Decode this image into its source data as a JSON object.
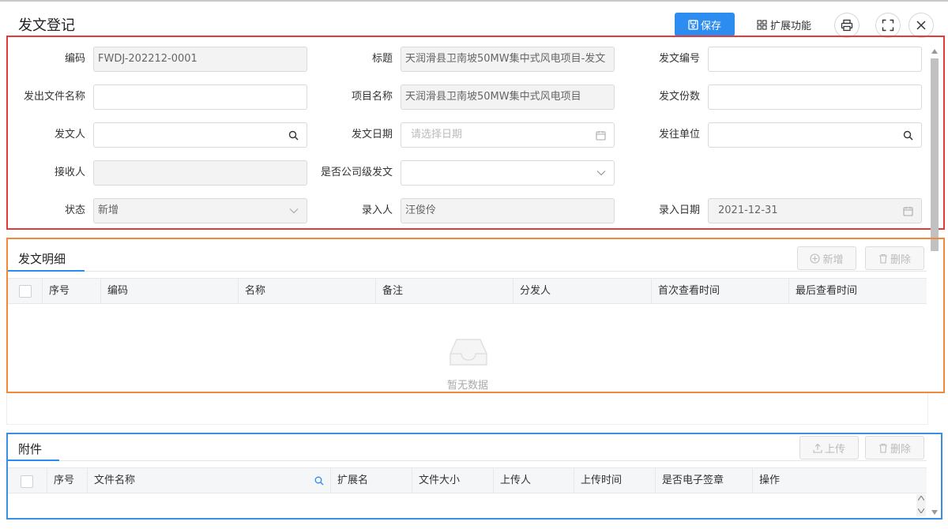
{
  "header": {
    "title": "发文登记",
    "save_label": "保存",
    "ext_label": "扩展功能"
  },
  "form": {
    "code_label": "编码",
    "code_value": "FWDJ-202212-0001",
    "title_label": "标题",
    "title_value": "天润滑县卫南坡50MW集中式风电项目-发文",
    "doc_no_label": "发文编号",
    "doc_no_value": "",
    "out_file_label": "发出文件名称",
    "out_file_value": "",
    "project_label": "项目名称",
    "project_value": "天润滑县卫南坡50MW集中式风电项目",
    "copies_label": "发文份数",
    "copies_value": "",
    "sender_label": "发文人",
    "sender_value": "",
    "date_label": "发文日期",
    "date_placeholder": "请选择日期",
    "dest_label": "发往单位",
    "dest_value": "",
    "receiver_label": "接收人",
    "receiver_value": "",
    "company_label": "是否公司级发文",
    "company_value": "",
    "status_label": "状态",
    "status_value": "新增",
    "entry_by_label": "录入人",
    "entry_by_value": "汪俊伶",
    "entry_date_label": "录入日期",
    "entry_date_value": "2021-12-31"
  },
  "detail": {
    "title": "发文明细",
    "add_label": "新增",
    "delete_label": "删除",
    "columns": [
      "序号",
      "编码",
      "名称",
      "备注",
      "分发人",
      "首次查看时间",
      "最后查看时间"
    ],
    "empty_text": "暂无数据"
  },
  "attach": {
    "title": "附件",
    "upload_label": "上传",
    "delete_label": "删除",
    "columns": [
      "序号",
      "文件名称",
      "扩展名",
      "文件大小",
      "上传人",
      "上传时间",
      "是否电子签章",
      "操作"
    ]
  },
  "colors": {
    "accent": "#2d8cf0",
    "red_frame": "#e53a3a",
    "orange_frame": "#ee8a3a",
    "blue_frame": "#3a8fe0"
  }
}
